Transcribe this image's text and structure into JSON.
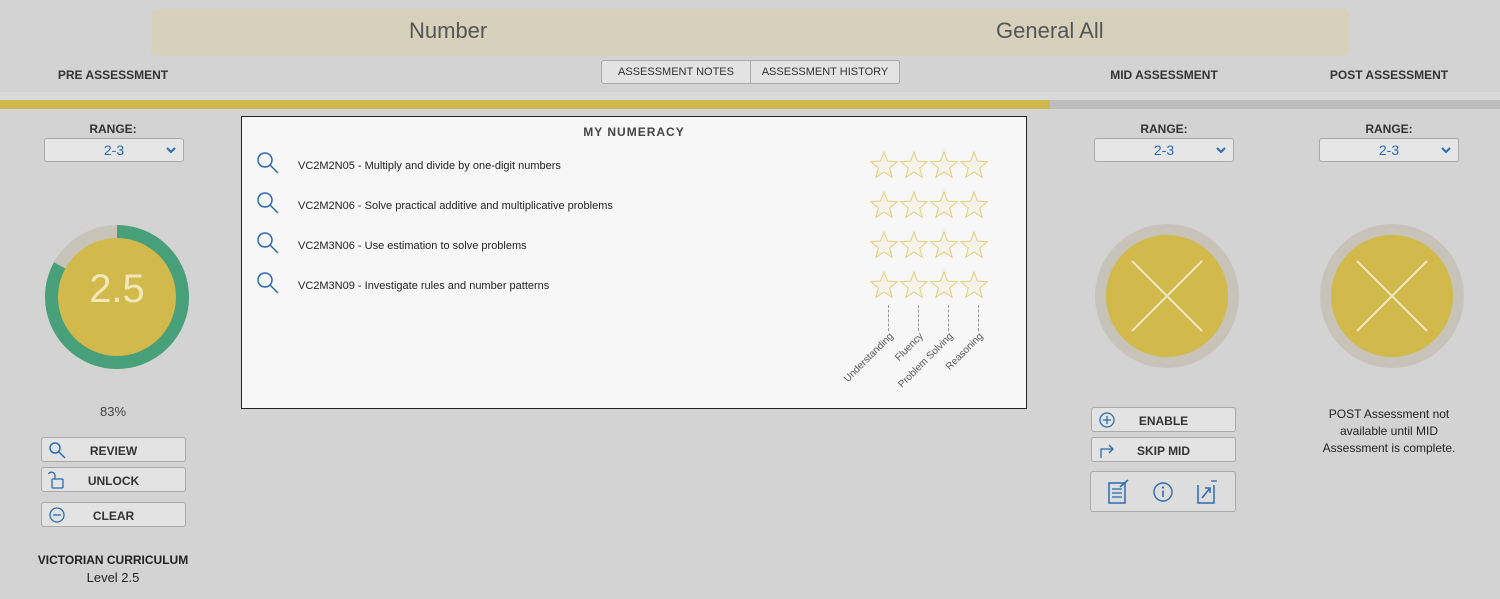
{
  "header": {
    "subject": "Number",
    "group": "General All"
  },
  "columns": {
    "pre": "PRE ASSESSMENT",
    "mid": "MID ASSESSMENT",
    "post": "POST ASSESSMENT"
  },
  "tabs": {
    "notes": "ASSESSMENT NOTES",
    "history": "ASSESSMENT HISTORY"
  },
  "progress": {
    "fraction": 0.7,
    "fill_color": "#d0b84c",
    "track_color": "#bdbdbd"
  },
  "pre": {
    "range_label": "RANGE:",
    "range_value": "2-3",
    "score": "2.5",
    "score_fraction": 0.83,
    "percent": "83%",
    "buttons": {
      "review": "REVIEW",
      "unlock": "UNLOCK",
      "clear": "CLEAR"
    },
    "curriculum_title": "VICTORIAN CURRICULUM",
    "curriculum_level": "Level 2.5",
    "ring_color": "#48a07a",
    "core_color": "#d1b94c"
  },
  "mid": {
    "range_label": "RANGE:",
    "range_value": "2-3",
    "status_icon": "x-icon",
    "buttons": {
      "enable": "ENABLE",
      "skip": "SKIP MID"
    },
    "action_icons": [
      "notes-icon",
      "info-icon",
      "upload-icon"
    ]
  },
  "post": {
    "range_label": "RANGE:",
    "range_value": "2-3",
    "status_icon": "x-icon",
    "message": "POST Assessment not available until MID Assessment is complete."
  },
  "numeracy": {
    "title": "MY NUMERACY",
    "rows": [
      {
        "code_text": "VC2M2N05 - Multiply and divide by one-digit numbers",
        "stars": [
          0,
          0,
          0,
          0
        ]
      },
      {
        "code_text": "VC2M2N06 - Solve practical additive and multiplicative problems",
        "stars": [
          0,
          0,
          0,
          0
        ]
      },
      {
        "code_text": "VC2M3N06 - Use estimation to solve problems",
        "stars": [
          0,
          0,
          0,
          0
        ]
      },
      {
        "code_text": "VC2M3N09 - Investigate rules and number patterns",
        "stars": [
          0,
          0,
          0,
          0
        ]
      }
    ],
    "proficiencies": [
      "Understanding",
      "Fluency",
      "Problem Solving",
      "Reasoning"
    ]
  }
}
